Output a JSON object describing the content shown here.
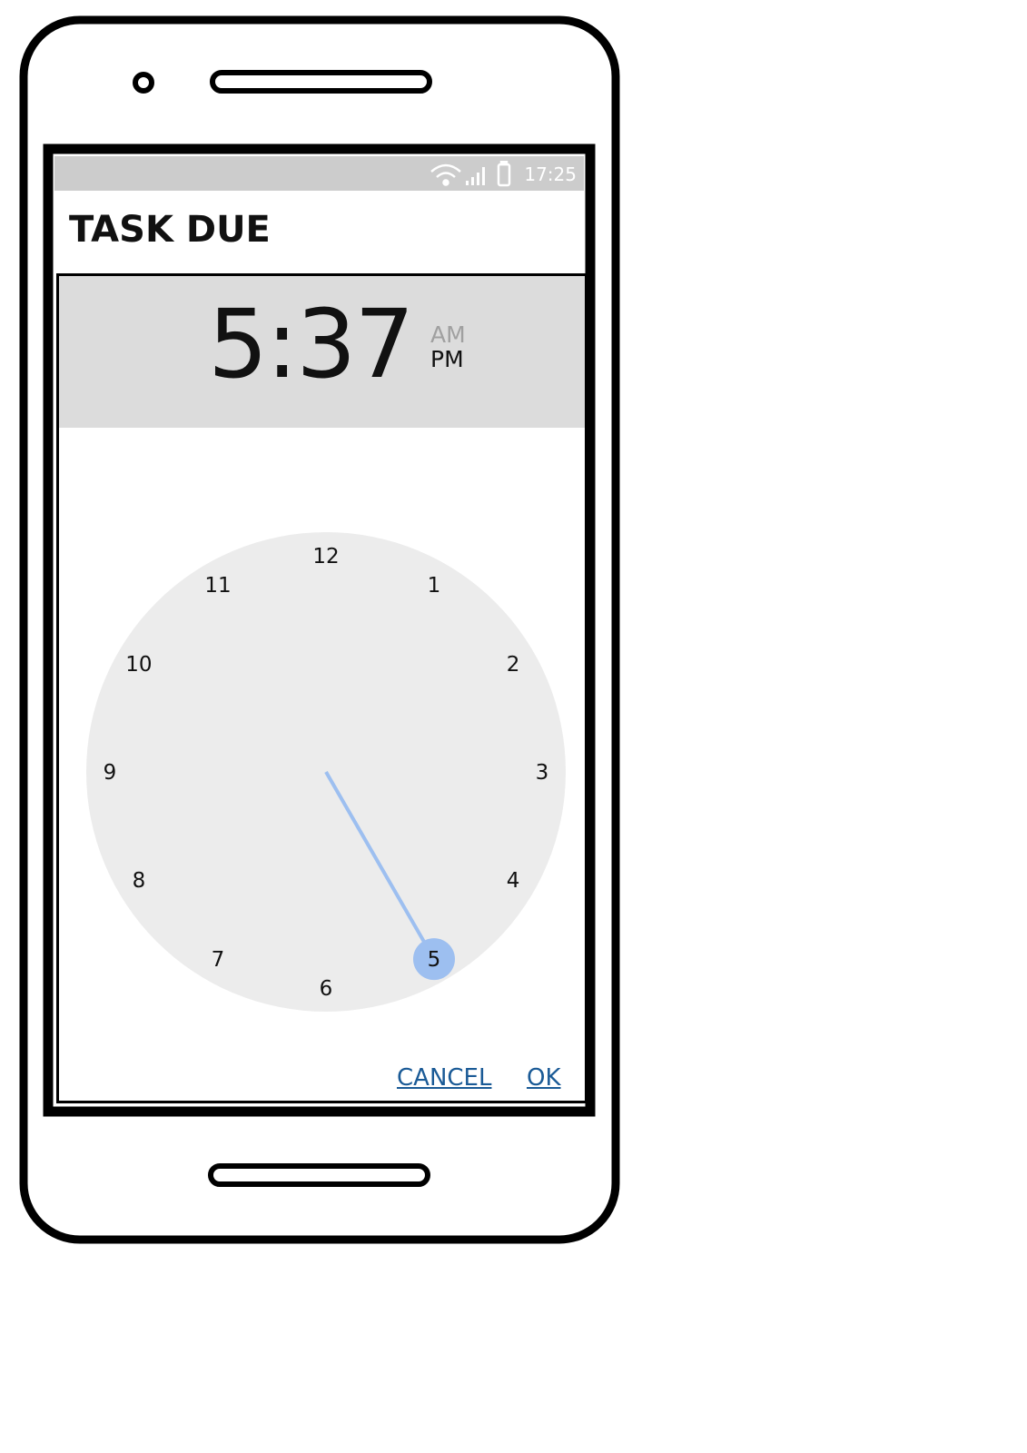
{
  "status_bar": {
    "time": "17:25",
    "icons": [
      "wifi-icon",
      "signal-icon",
      "battery-icon"
    ]
  },
  "app_bar": {
    "title": "TASK DUE"
  },
  "time_picker": {
    "time": "5:37",
    "am_label": "AM",
    "pm_label": "PM",
    "selected_period": "PM",
    "selected_hour": 5,
    "hours": [
      "12",
      "1",
      "2",
      "3",
      "4",
      "5",
      "6",
      "7",
      "8",
      "9",
      "10",
      "11"
    ],
    "colors": {
      "dial": "#ececec",
      "hand": "#9dbff0",
      "header": "#dcdcdc",
      "link": "#1a5a96"
    }
  },
  "actions": {
    "cancel": "CANCEL",
    "ok": "OK"
  }
}
